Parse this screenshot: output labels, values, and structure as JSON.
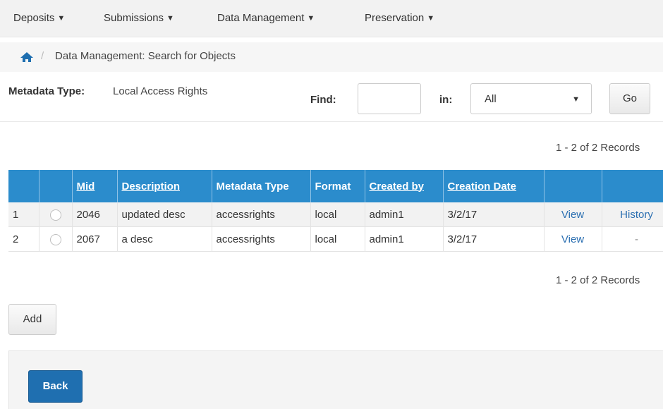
{
  "nav": {
    "items": [
      {
        "label": "Deposits"
      },
      {
        "label": "Submissions"
      },
      {
        "label": "Data Management"
      },
      {
        "label": "Preservation"
      }
    ]
  },
  "breadcrumb": {
    "separator": "/",
    "current": "Data Management: Search for Objects"
  },
  "search": {
    "metadata_type_label": "Metadata Type:",
    "metadata_type_value": "Local Access Rights",
    "find_label": "Find:",
    "find_value": "",
    "in_label": "in:",
    "in_selected": "All",
    "go_label": "Go"
  },
  "records_text": "1 - 2 of 2 Records",
  "table": {
    "columns": [
      "",
      "",
      "Mid",
      "Description",
      "Metadata Type",
      "Format",
      "Created by",
      "Creation Date",
      "",
      ""
    ],
    "rows": [
      {
        "index": "1",
        "mid": "2046",
        "description": "updated desc",
        "metadata_type": "accessrights",
        "format": "local",
        "created_by": "admin1",
        "creation_date": "3/2/17",
        "view": "View",
        "history": "History"
      },
      {
        "index": "2",
        "mid": "2067",
        "description": "a desc",
        "metadata_type": "accessrights",
        "format": "local",
        "created_by": "admin1",
        "creation_date": "3/2/17",
        "view": "View",
        "history": "-"
      }
    ]
  },
  "buttons": {
    "add": "Add",
    "back": "Back"
  },
  "colors": {
    "header_blue": "#2b8ccc",
    "primary_button": "#1f6fb0",
    "link": "#2b6fb1"
  }
}
